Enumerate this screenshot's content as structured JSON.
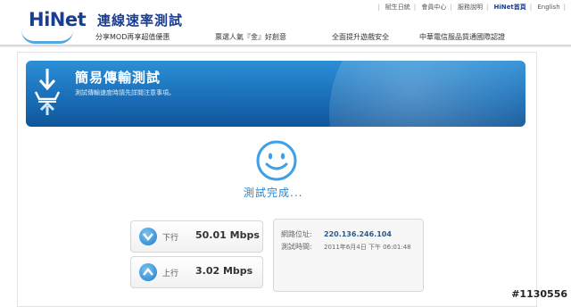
{
  "header": {
    "logo": "HiNet",
    "site_title": "連線速率測試",
    "toplinks": [
      "賦生日統",
      "會員中心",
      "服務說明",
      "HiNet首頁",
      "English"
    ],
    "nav": [
      "分享MOD再享超值優惠",
      "票選人氣『金』好創意",
      "全面提升遊戲安全",
      "中華電信服品質通國際認證"
    ]
  },
  "banner": {
    "title": "簡易傳輸測試",
    "subtitle": "測試傳輸速度時請先詳閱注意事項。"
  },
  "result": {
    "status": "測試完成...",
    "download_label": "下行",
    "download_value": "50.01 Mbps",
    "upload_label": "上行",
    "upload_value": "3.02 Mbps"
  },
  "info": {
    "ip_label": "網路位址:",
    "ip_value": "220.136.246.104",
    "time_label": "測試時間:",
    "time_value": "2011年6月4日 下午 06:01:48"
  },
  "watermark": "#1130556",
  "colors": {
    "brand": "#1a3d8f",
    "accent": "#2a86d2",
    "banner": "#1a6fb8"
  },
  "icons": [
    "download-tray-icon",
    "smile-icon",
    "down-arrow-icon",
    "up-arrow-icon"
  ]
}
